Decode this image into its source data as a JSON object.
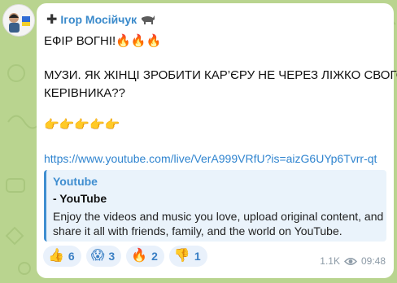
{
  "post": {
    "sender_name": "Ігор Мосійчук",
    "sender_prefix_icon": "plus-icon",
    "sender_suffix_icon": "bull-icon",
    "line1": "ЕФІР ВОГНІ!🔥🔥🔥",
    "line2": "МУЗИ. ЯК ЖІНЦІ ЗРОБИТИ КАР’ЄРУ НЕ ЧЕРЕЗ ЛІЖКО СВОГО",
    "line3": "КЕРІВНИКА??",
    "line4": "👉👉👉👉👉",
    "link": "https://www.youtube.com/live/VerA999VRfU?is=aizG6UYp6Tvrr-qt"
  },
  "preview": {
    "site": "Youtube",
    "title": "- YouTube",
    "description": "Enjoy the videos and music you love, upload original content, and share it all with friends, family, and the world on YouTube."
  },
  "reactions": [
    {
      "emoji": "👍",
      "count": "6"
    },
    {
      "emoji": "😱",
      "count": "3"
    },
    {
      "emoji": "🔥",
      "count": "2"
    },
    {
      "emoji": "👎",
      "count": "1"
    }
  ],
  "meta": {
    "views": "1.1K",
    "time": "09:48"
  },
  "colors": {
    "background": "#b9d48f",
    "sender": "#3a8acb",
    "link": "#2f84cf"
  }
}
